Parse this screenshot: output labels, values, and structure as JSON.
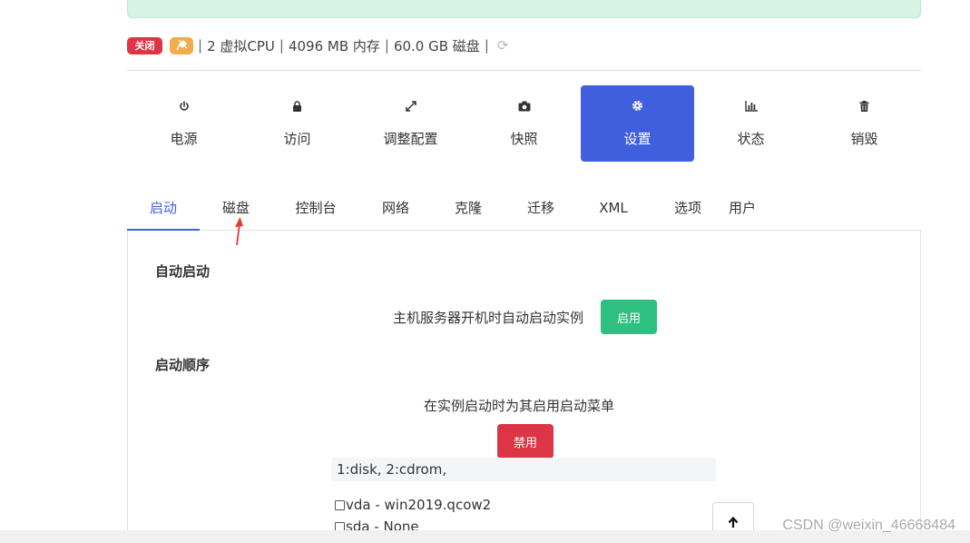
{
  "status": {
    "state_badge": "关闭",
    "specs": [
      "2 虚拟CPU",
      "4096 MB 内存",
      "60.0 GB 磁盘"
    ]
  },
  "actions": [
    {
      "label": "电源",
      "icon": "power-icon"
    },
    {
      "label": "访问",
      "icon": "lock-icon"
    },
    {
      "label": "调整配置",
      "icon": "resize-icon"
    },
    {
      "label": "快照",
      "icon": "camera-icon"
    },
    {
      "label": "设置",
      "icon": "gear-icon"
    },
    {
      "label": "状态",
      "icon": "bar-chart-icon"
    },
    {
      "label": "销毁",
      "icon": "trash-icon"
    }
  ],
  "tabs": [
    "启动",
    "磁盘",
    "控制台",
    "网络",
    "克隆",
    "迁移",
    "XML",
    "选项",
    "用户"
  ],
  "autostart": {
    "heading": "自动启动",
    "description": "主机服务器开机时自动启动实例",
    "button": "启用"
  },
  "boot_order": {
    "heading": "启动顺序",
    "description": "在实例启动时为其启用启动菜单",
    "button": "禁用",
    "order_value": "1:disk, 2:cdrom,",
    "devices": [
      "vda - win2019.qcow2",
      "sda - None"
    ]
  },
  "watermark": "CSDN @weixin_46668484",
  "colors": {
    "accent": "#3f5fdf",
    "enable": "#2fbf80",
    "danger": "#dc3545",
    "warning": "#f0ad4e"
  }
}
